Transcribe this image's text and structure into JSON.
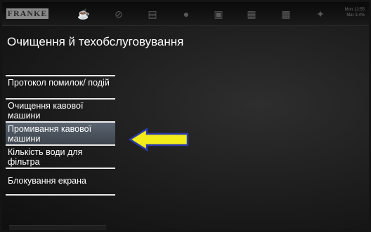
{
  "header": {
    "brand": "FRANKE",
    "date_line1": "Mon 12:55",
    "date_line2": "Mar 3.4%",
    "icons": [
      "cup-icon",
      "milk-icon",
      "cleaning-icon",
      "drop-icon",
      "coffee-machine-icon",
      "counter-icon",
      "recipe-icon",
      "wrench-icon"
    ]
  },
  "page": {
    "title": "Очищення й техобслуговування"
  },
  "menu": {
    "items": [
      {
        "label": "Протокол помилок/ подій"
      },
      {
        "label": "Очищення кавової машини"
      },
      {
        "label": "Промивання кавової машини"
      },
      {
        "label": "Кількість води для фільтра"
      },
      {
        "label": "Блокування екрана"
      }
    ],
    "selected_index": 2
  },
  "colors": {
    "arrow_fill": "#f2ec1a",
    "arrow_stroke": "#2a3aa8",
    "selected_bg": "#55606c"
  }
}
